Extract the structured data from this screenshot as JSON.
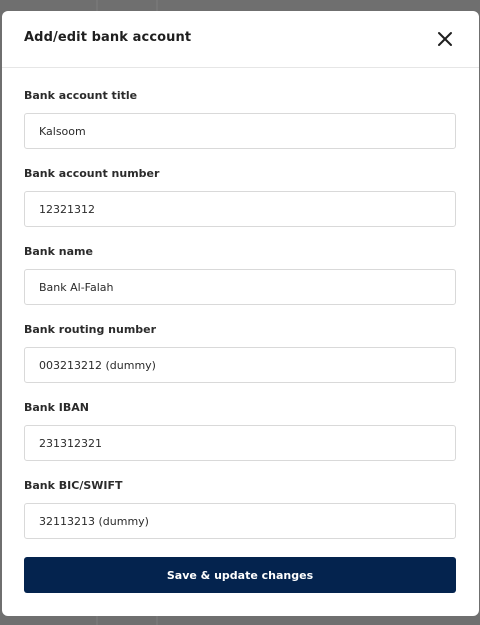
{
  "modal": {
    "title": "Add/edit bank account",
    "close_icon": "close-icon"
  },
  "fields": [
    {
      "label": "Bank account title",
      "value": "Kalsoom"
    },
    {
      "label": "Bank account number",
      "value": "12321312"
    },
    {
      "label": "Bank name",
      "value": "Bank Al-Falah"
    },
    {
      "label": "Bank routing number",
      "value": "003213212 (dummy)"
    },
    {
      "label": "Bank IBAN",
      "value": "231312321"
    },
    {
      "label": "Bank BIC/SWIFT",
      "value": "32113213 (dummy)"
    }
  ],
  "actions": {
    "submit_label": "Save & update changes"
  },
  "colors": {
    "primary": "#04234e",
    "overlay": "#6f6f6f"
  }
}
